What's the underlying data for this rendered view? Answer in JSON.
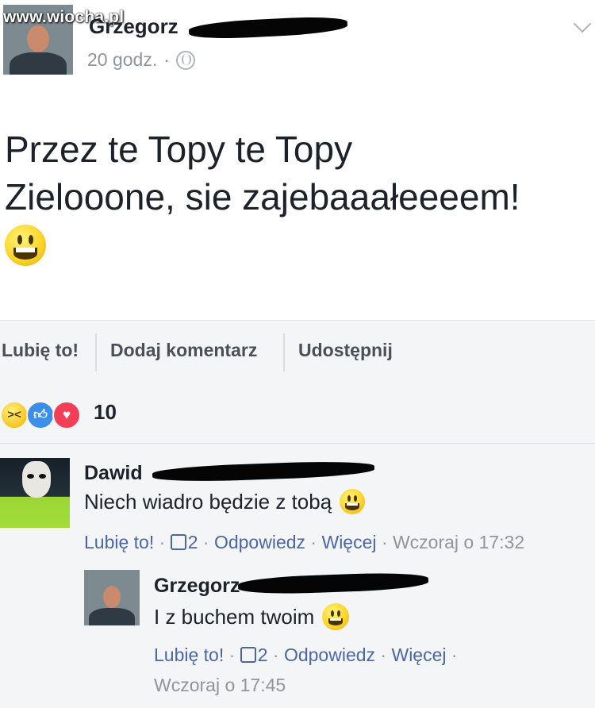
{
  "watermark": "www.wiocha.pl",
  "post": {
    "author": "Grzegorz",
    "time": "20 godz.",
    "separator": "·",
    "line1": "Przez te Topy te Topy",
    "line2": "Zielooone, sie zajebaaałeeeem!"
  },
  "actions": {
    "like": "Lubię to!",
    "comment": "Dodaj komentarz",
    "share": "Udostępnij"
  },
  "reactions": {
    "count": "10",
    "types": [
      "haha-icon",
      "like-icon",
      "love-icon"
    ]
  },
  "comments": [
    {
      "name": "Dawid",
      "text": "Niech wiadro będzie z tobą",
      "like": "Lubię to!",
      "likes": "2",
      "reply": "Odpowiedz",
      "more": "Więcej",
      "time": "Wczoraj o 17:32"
    },
    {
      "name": "Grzegorz",
      "text": "I z buchem twoim",
      "like": "Lubię to!",
      "likes": "2",
      "reply": "Odpowiedz",
      "more": "Więcej",
      "time": "Wczoraj o 17:45"
    }
  ],
  "colors": {
    "link": "#4b67a1",
    "meta": "#90949c",
    "background": "#f4f5f7",
    "text": "#1d2129"
  }
}
